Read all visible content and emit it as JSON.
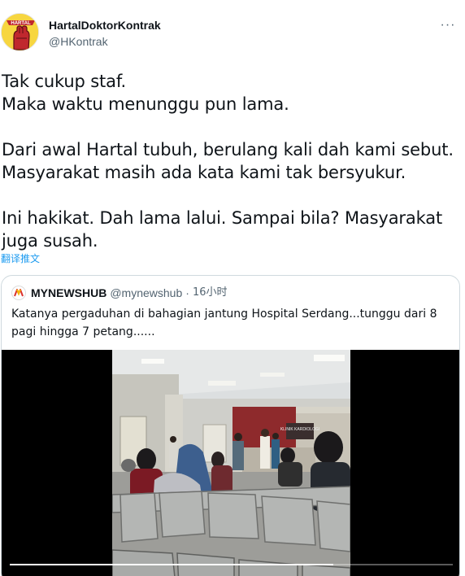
{
  "author": {
    "display_name": "HartalDoktorKontrak",
    "handle": "@HKontrak",
    "avatar_icon": "fist-logo-icon",
    "avatar_text": "HARTAL"
  },
  "tweet": {
    "line1": "Tak cukup staf.",
    "line2": "Maka waktu menunggu pun lama.",
    "line3": "Dari awal Hartal tubuh, berulang kali dah kami sebut.",
    "line4": "Masyarakat masih ada kata kami tak bersyukur.",
    "line5": "Ini hakikat. Dah lama lalui. Sampai bila? Masyarakat",
    "line6": "juga susah."
  },
  "translate_label": "翻译推文",
  "more_label": "···",
  "quoted": {
    "name": "MYNEWSHUB",
    "handle": "@mynewshub",
    "dot": "·",
    "time": "16小时",
    "text": "Katanya pergaduhan di bahagian jantung Hospital Serdang...tunggu dari 8 pagi hingga 7 petang......",
    "sign_text": "KLINIK KARDIOLOGI"
  },
  "video": {
    "progress": 0.73
  },
  "colors": {
    "accent": "#1d9bf0",
    "secondary_text": "#536471",
    "border": "#cfd9de"
  }
}
